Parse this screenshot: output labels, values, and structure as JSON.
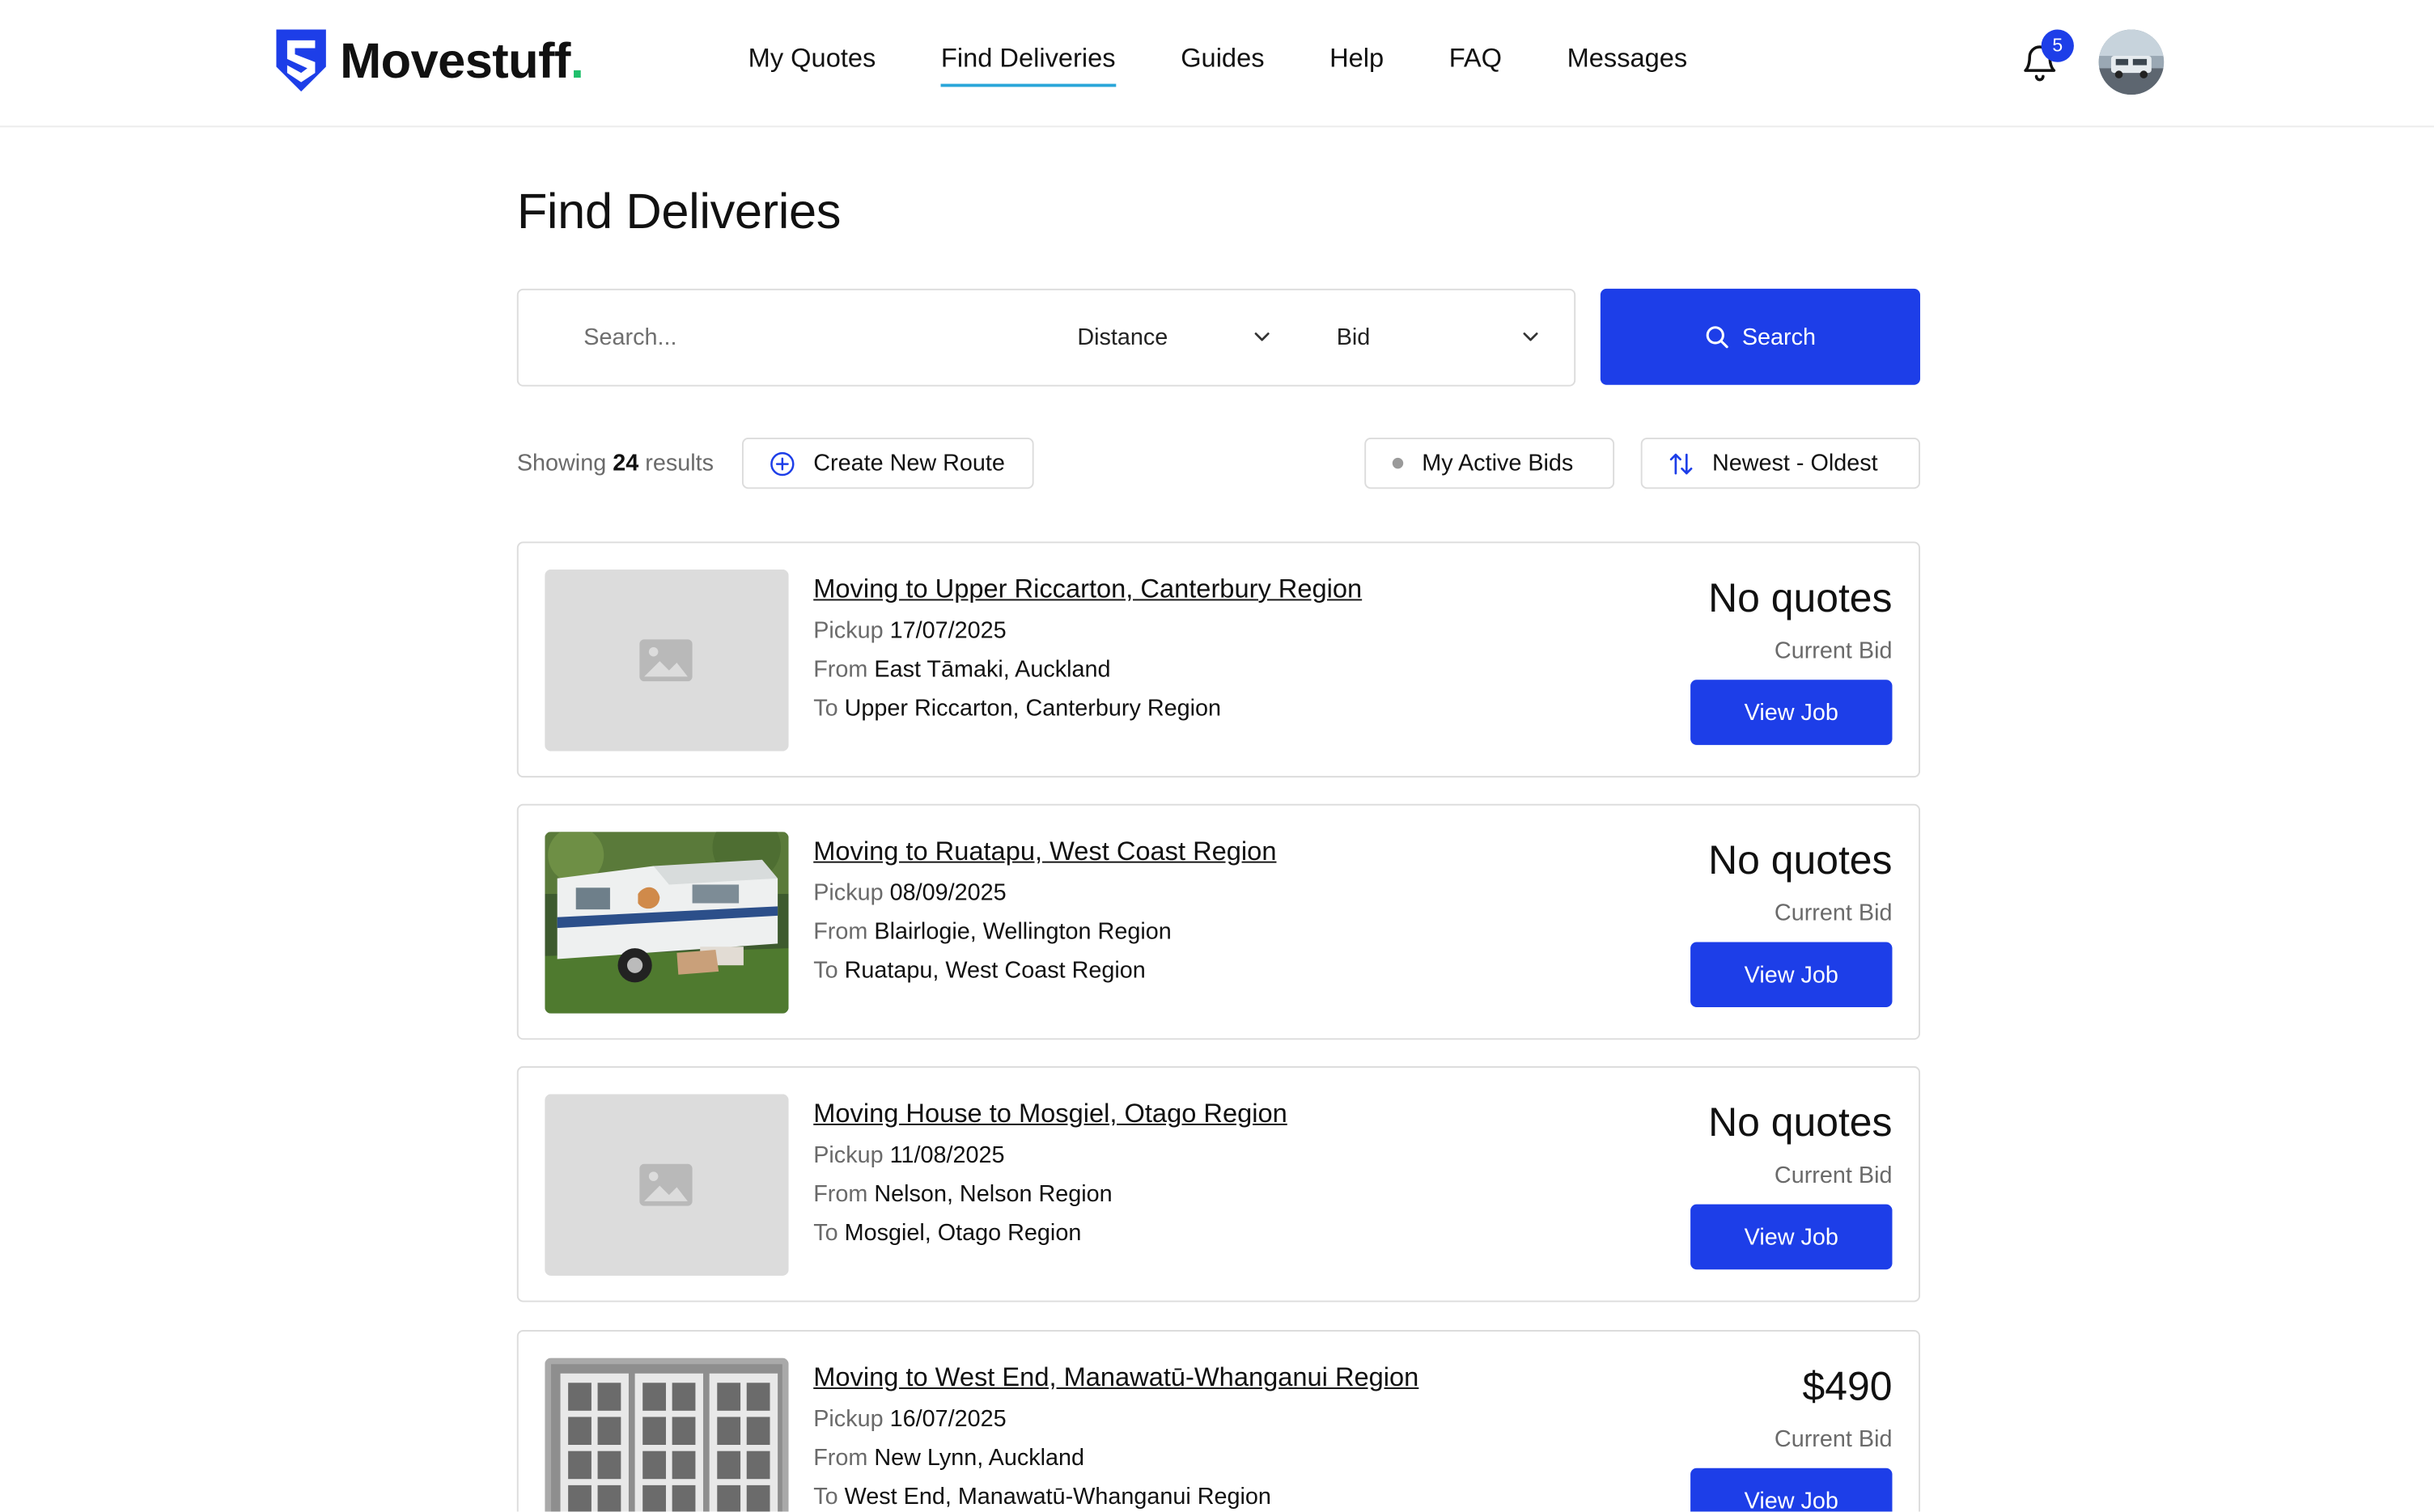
{
  "brand": {
    "name": "Movestuff",
    "dot": "."
  },
  "nav": {
    "items": [
      {
        "label": "My Quotes"
      },
      {
        "label": "Find Deliveries",
        "active": true
      },
      {
        "label": "Guides"
      },
      {
        "label": "Help"
      },
      {
        "label": "FAQ"
      },
      {
        "label": "Messages"
      }
    ]
  },
  "notifications": {
    "icon": "bell-icon",
    "count": "5"
  },
  "user": {
    "avatar": "user-avatar"
  },
  "page": {
    "title": "Find Deliveries"
  },
  "search": {
    "placeholder": "Search...",
    "value": "",
    "distance_label": "Distance",
    "bid_label": "Bid",
    "button_label": "Search"
  },
  "toolbar": {
    "showing_prefix": "Showing",
    "count": "24",
    "showing_suffix": "results",
    "create_route_label": "Create New Route",
    "active_bids_label": "My Active Bids",
    "sort_label": "Newest - Oldest"
  },
  "jobs": [
    {
      "title": "Moving to Upper Riccarton, Canterbury Region",
      "pickup_label": "Pickup",
      "pickup": "17/07/2025",
      "from_label": "From",
      "from": "East Tāmaki, Auckland",
      "to_label": "To",
      "to": "Upper Riccarton, Canterbury Region",
      "bid": "No quotes",
      "bid_label": "Current Bid",
      "button": "View Job",
      "image": "placeholder-image"
    },
    {
      "title": "Moving to Ruatapu, West Coast Region",
      "pickup_label": "Pickup",
      "pickup": "08/09/2025",
      "from_label": "From",
      "from": "Blairlogie, Wellington Region",
      "to_label": "To",
      "to": "Ruatapu, West Coast Region",
      "bid": "No quotes",
      "bid_label": "Current Bid",
      "button": "View Job",
      "image": "caravan-photo"
    },
    {
      "title": "Moving House to Mosgiel, Otago Region",
      "pickup_label": "Pickup",
      "pickup": "11/08/2025",
      "from_label": "From",
      "from": "Nelson, Nelson Region",
      "to_label": "To",
      "to": "Mosgiel, Otago Region",
      "bid": "No quotes",
      "bid_label": "Current Bid",
      "button": "View Job",
      "image": "placeholder-image"
    },
    {
      "title": "Moving to West End, Manawatū-Whanganui Region",
      "pickup_label": "Pickup",
      "pickup": "16/07/2025",
      "from_label": "From",
      "from": "New Lynn, Auckland",
      "to_label": "To",
      "to": "West End, Manawatū-Whanganui Region",
      "bid": "$490",
      "bid_label": "Current Bid",
      "button": "View Job",
      "image": "doors-photo"
    }
  ],
  "colors": {
    "primary": "#1d3ee8",
    "active_underline": "#2aa6d9",
    "brand_dot": "#1fbf6b",
    "border": "#dcdcdc",
    "muted_text": "#6a6a6a"
  }
}
